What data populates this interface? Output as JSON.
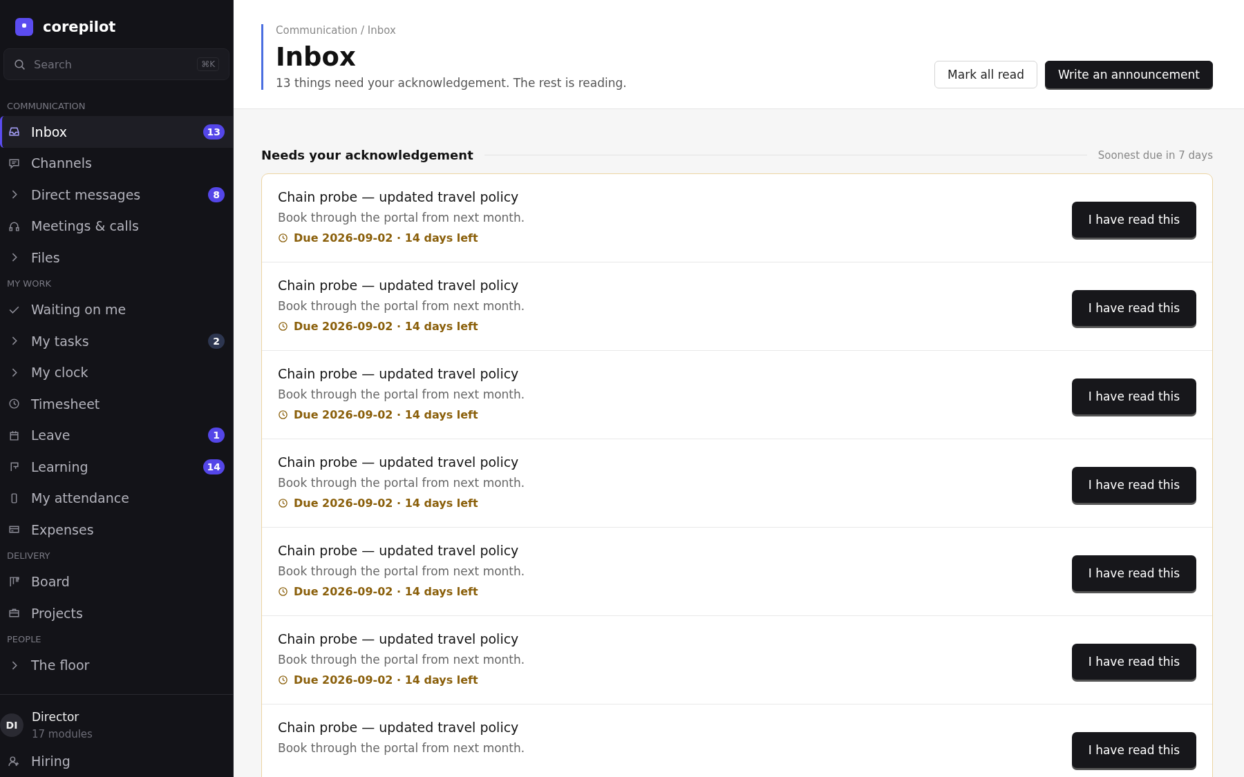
{
  "brand": {
    "name": "corepilot"
  },
  "search": {
    "placeholder": "Search",
    "shortcut": "⌘K"
  },
  "sections": [
    {
      "label": "COMMUNICATION",
      "items": [
        {
          "label": "Inbox",
          "kind": "link",
          "selected": true,
          "badge": {
            "text": "13",
            "color": "#5446e8"
          }
        },
        {
          "label": "Channels",
          "kind": "link",
          "selected": false
        },
        {
          "label": "Direct messages",
          "kind": "expandable",
          "selected": false,
          "badge": {
            "text": "8",
            "color": "#5446e8"
          }
        },
        {
          "label": "Meetings & calls",
          "kind": "link",
          "selected": false
        },
        {
          "label": "Files",
          "kind": "expandable",
          "selected": false
        }
      ]
    },
    {
      "label": "MY WORK",
      "items": [
        {
          "label": "Waiting on me",
          "kind": "link",
          "selected": false
        },
        {
          "label": "My tasks",
          "kind": "expandable",
          "selected": false,
          "badge": {
            "text": "2",
            "color": "#2d3650"
          }
        },
        {
          "label": "My clock",
          "kind": "expandable",
          "selected": false
        },
        {
          "label": "Timesheet",
          "kind": "link",
          "selected": false
        },
        {
          "label": "Leave",
          "kind": "link",
          "selected": false,
          "badge": {
            "text": "1",
            "color": "#5446e8"
          }
        },
        {
          "label": "Learning",
          "kind": "link",
          "selected": false,
          "badge": {
            "text": "14",
            "color": "#5446e8"
          }
        },
        {
          "label": "My attendance",
          "kind": "link",
          "selected": false
        },
        {
          "label": "Expenses",
          "kind": "link",
          "selected": false
        }
      ]
    },
    {
      "label": "DELIVERY",
      "items": [
        {
          "label": "Board",
          "kind": "link",
          "selected": false
        },
        {
          "label": "Projects",
          "kind": "link",
          "selected": false
        }
      ]
    },
    {
      "label": "PEOPLE",
      "items": [
        {
          "label": "The floor",
          "kind": "expandable",
          "selected": false
        }
      ]
    }
  ],
  "user": {
    "initials": "DI",
    "name": "Director",
    "detail": "17 modules"
  },
  "footer_items": [
    {
      "label": "Hiring"
    }
  ],
  "header": {
    "breadcrumb": "Communication / Inbox",
    "title": "Inbox",
    "subtitle": "13 things need your acknowledgement. The rest is reading.",
    "buttons": [
      {
        "label": "Mark all read",
        "kind": "secondary"
      },
      {
        "label": "Write an announcement",
        "kind": "primary"
      }
    ]
  },
  "section": {
    "title": "Needs your acknowledgement",
    "note": "Soonest due in 7 days"
  },
  "cards": [
    {
      "title": "Chain probe — updated travel policy",
      "body": "Book through the portal from next month.",
      "due": "Due 2026-09-02 · 14 days left",
      "action": "I have read this"
    },
    {
      "title": "Chain probe — updated travel policy",
      "body": "Book through the portal from next month.",
      "due": "Due 2026-09-02 · 14 days left",
      "action": "I have read this"
    },
    {
      "title": "Chain probe — updated travel policy",
      "body": "Book through the portal from next month.",
      "due": "Due 2026-09-02 · 14 days left",
      "action": "I have read this"
    },
    {
      "title": "Chain probe — updated travel policy",
      "body": "Book through the portal from next month.",
      "due": "Due 2026-09-02 · 14 days left",
      "action": "I have read this"
    },
    {
      "title": "Chain probe — updated travel policy",
      "body": "Book through the portal from next month.",
      "due": "Due 2026-09-02 · 14 days left",
      "action": "I have read this"
    },
    {
      "title": "Chain probe — updated travel policy",
      "body": "Book through the portal from next month.",
      "due": "Due 2026-09-02 · 14 days left",
      "action": "I have read this"
    },
    {
      "title": "Chain probe — updated travel policy",
      "body": "Book through the portal from next month.",
      "action": "I have read this"
    }
  ]
}
